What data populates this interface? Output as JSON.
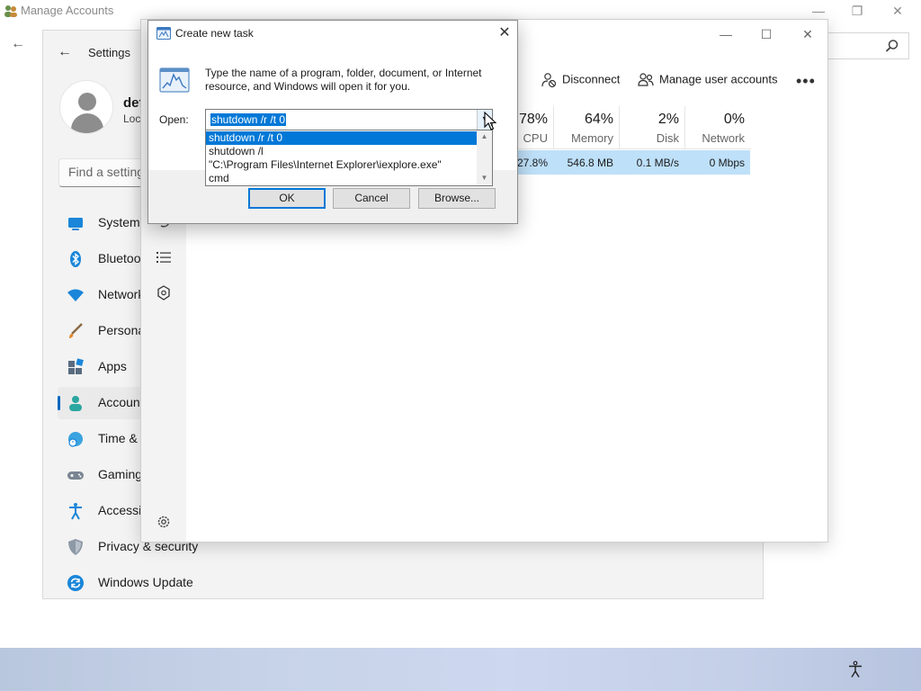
{
  "outer_window": {
    "title": "Manage Accounts",
    "minimize_icon": "minimize-icon",
    "maximize_icon": "maximize-icon",
    "close_icon": "close-icon"
  },
  "settings": {
    "title": "Settings",
    "user_name": "def",
    "user_sub": "Loca",
    "search_placeholder": "Find a setting",
    "nav": [
      {
        "label": "System",
        "icon": "system-icon"
      },
      {
        "label": "Bluetoot",
        "icon": "bluetooth-icon"
      },
      {
        "label": "Network",
        "icon": "network-icon"
      },
      {
        "label": "Persona",
        "icon": "personalization-icon"
      },
      {
        "label": "Apps",
        "icon": "apps-icon"
      },
      {
        "label": "Account",
        "icon": "accounts-icon",
        "selected": true
      },
      {
        "label": "Time &",
        "icon": "time-icon"
      },
      {
        "label": "Gaming",
        "icon": "gaming-icon"
      },
      {
        "label": "Accessib",
        "icon": "accessibility-icon"
      },
      {
        "label": "Privacy & security",
        "icon": "privacy-shield-icon"
      },
      {
        "label": "Windows Update",
        "icon": "windows-update-icon"
      }
    ]
  },
  "task_manager": {
    "commands": {
      "disconnect": "Disconnect",
      "manage_user_accounts": "Manage user accounts",
      "more": "•••"
    },
    "columns": [
      {
        "pct": "78%",
        "caption": "CPU"
      },
      {
        "pct": "64%",
        "caption": "Memory"
      },
      {
        "pct": "2%",
        "caption": "Disk"
      },
      {
        "pct": "0%",
        "caption": "Network"
      }
    ],
    "row_values": [
      "27.8%",
      "546.8 MB",
      "0.1 MB/s",
      "0 Mbps"
    ]
  },
  "run_dialog": {
    "title": "Create new task",
    "description": "Type the name of a program, folder, document, or Internet resource, and Windows will open it for you.",
    "open_label": "Open:",
    "open_value": "shutdown /r /t 0",
    "history": [
      "shutdown /r /t 0",
      "shutdown /l",
      "\"C:\\Program Files\\Internet Explorer\\iexplore.exe\"",
      "cmd"
    ],
    "buttons": {
      "ok": "OK",
      "cancel": "Cancel",
      "browse": "Browse..."
    }
  },
  "colors": {
    "accent": "#0078d7",
    "selection_row": "#bee0f9",
    "settings_bg": "#f3f3f3"
  }
}
